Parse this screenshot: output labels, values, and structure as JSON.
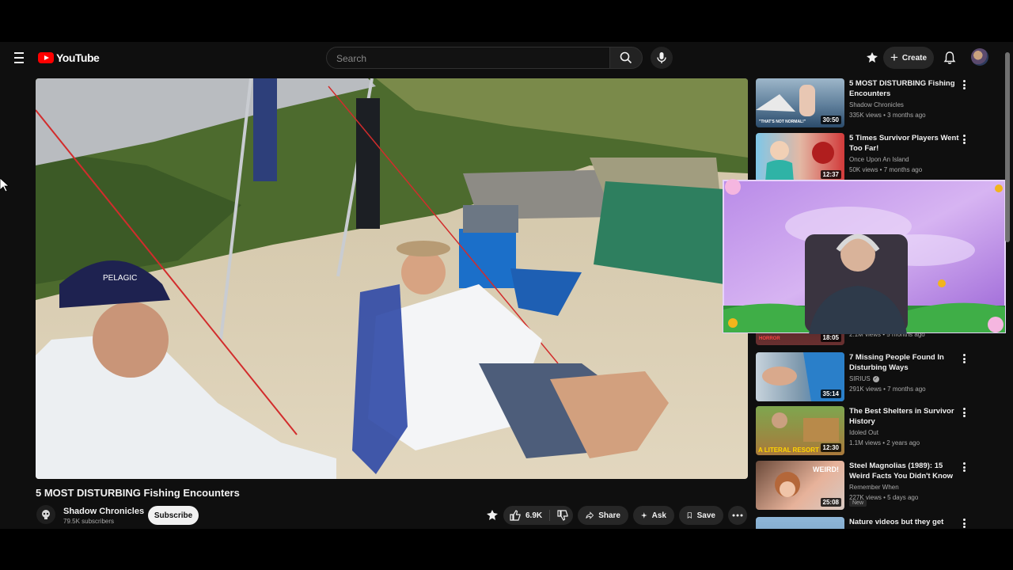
{
  "header": {
    "logo_text": "YouTube",
    "search_placeholder": "Search",
    "create_label": "Create"
  },
  "video": {
    "title": "5 MOST DISTURBING Fishing Encounters",
    "channel": "Shadow Chronicles",
    "subscribers": "79.5K subscribers",
    "subscribe_label": "Subscribe",
    "likes": "6.9K",
    "share_label": "Share",
    "ask_label": "Ask",
    "save_label": "Save",
    "player_cap_text": "PELAGIC"
  },
  "recommendations": [
    {
      "title": "5 MOST DISTURBING Fishing Encounters",
      "channel": "Shadow Chronicles",
      "meta": "335K views • 3 months ago",
      "duration": "30:50",
      "thumb_caption": "\"THAT'S NOT NORMAL!\""
    },
    {
      "title": "5 Times Survivor Players Went Too Far!",
      "channel": "Once Upon An Island",
      "meta": "50K views • 7 months ago",
      "duration": "12:37"
    },
    {
      "title": "",
      "channel": "",
      "meta": "2.1M views • 5 months ago",
      "duration": "18:05",
      "thumb_caption": "HORROR"
    },
    {
      "title": "7 Missing People Found In Disturbing Ways",
      "channel": "SIRIUS",
      "meta": "291K views • 7 months ago",
      "duration": "35:14",
      "verified": true
    },
    {
      "title": "The Best Shelters in Survivor History",
      "channel": "Idoled Out",
      "meta": "1.1M views • 2 years ago",
      "duration": "12:30",
      "thumb_caption": "A LITERAL RESORT"
    },
    {
      "title": "Steel Magnolias (1989): 15 Weird Facts You Didn't Know",
      "channel": "Remember When",
      "meta": "227K views • 5 days ago",
      "duration": "25:08",
      "thumb_caption": "WEIRD!",
      "badge": "New"
    },
    {
      "title": "Nature videos but they get",
      "channel": "",
      "meta": "",
      "duration": ""
    }
  ],
  "colors": {
    "background": "#0f0f0f",
    "youtube_red": "#ff0000",
    "pill_bg": "#272727",
    "secondary_text": "#aaaaaa"
  }
}
